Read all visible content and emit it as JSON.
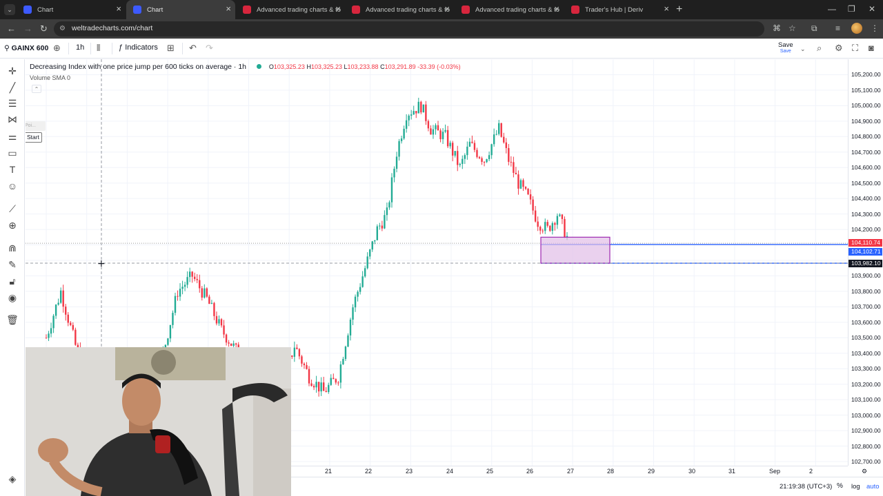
{
  "browser": {
    "tabs": [
      {
        "title": "Chart",
        "favicon_color": "#3d5afe",
        "active": false
      },
      {
        "title": "Chart",
        "favicon_color": "#3d5afe",
        "active": true
      },
      {
        "title": "Advanced trading charts & tools",
        "favicon_color": "#d7263d",
        "active": false
      },
      {
        "title": "Advanced trading charts & tools",
        "favicon_color": "#d7263d",
        "active": false
      },
      {
        "title": "Advanced trading charts & tools",
        "favicon_color": "#d7263d",
        "active": false
      },
      {
        "title": "Trader's Hub | Deriv",
        "favicon_color": "#d7263d",
        "active": false
      }
    ],
    "url": "weltradecharts.com/chart"
  },
  "toolbar": {
    "symbol": "GAINX 600",
    "interval": "1h",
    "indicators_label": "Indicators",
    "save_label": "Save",
    "save_sub": "Save"
  },
  "chart": {
    "title": "Decreasing Index with one price jump per 600 ticks on average · 1h",
    "ohlc": {
      "o_label": "O",
      "o": "103,325.23",
      "h_label": "H",
      "h": "103,325.23",
      "l_label": "L",
      "l": "103,233.88",
      "c_label": "C",
      "c": "103,291.89",
      "change": "-33.39 (-0.03%)"
    },
    "volume_label": "Volume SMA",
    "volume_value": "0",
    "poi_label": "Poi...",
    "start_label": "Start",
    "colors": {
      "up": "#22ab94",
      "down": "#f23645",
      "zone_fill": "#e1bee7",
      "zone_stroke": "#9c27b0",
      "line": "#2962ff"
    }
  },
  "chart_data": {
    "type": "candlestick",
    "ylim": [
      102700,
      105300
    ],
    "price_ticks": [
      "105,200.00",
      "105,100.00",
      "105,000.00",
      "104,900.00",
      "104,800.00",
      "104,700.00",
      "104,600.00",
      "104,500.00",
      "104,400.00",
      "104,300.00",
      "104,200.00",
      "103,900.00",
      "103,800.00",
      "103,700.00",
      "103,600.00",
      "103,500.00",
      "103,400.00",
      "103,300.00",
      "103,200.00",
      "103,100.00",
      "103,000.00",
      "102,900.00",
      "102,800.00",
      "102,700.00"
    ],
    "time_ticks": [
      "21",
      "22",
      "23",
      "24",
      "25",
      "26",
      "27",
      "28",
      "29",
      "30",
      "31",
      "Sep",
      "2"
    ],
    "price_labels": [
      {
        "text": "104,110.74",
        "color": "#f23645",
        "value": 104110.74
      },
      {
        "text": "104,102.71",
        "color": "#2962ff",
        "value": 104102.71
      },
      {
        "text": "103,982.10",
        "color": "#131722",
        "value": 103982.1
      }
    ],
    "path_points": [
      [
        0,
        103500
      ],
      [
        6,
        103800
      ],
      [
        12,
        103450
      ],
      [
        18,
        103200
      ],
      [
        24,
        103050
      ],
      [
        30,
        103000
      ],
      [
        36,
        103100
      ],
      [
        42,
        103200
      ],
      [
        48,
        103400
      ],
      [
        54,
        103800
      ],
      [
        60,
        103900
      ],
      [
        66,
        103750
      ],
      [
        72,
        103550
      ],
      [
        78,
        103420
      ],
      [
        84,
        103250
      ],
      [
        90,
        102950
      ],
      [
        96,
        103150
      ],
      [
        102,
        103450
      ],
      [
        108,
        103250
      ],
      [
        114,
        103150
      ],
      [
        120,
        103250
      ],
      [
        126,
        103700
      ],
      [
        132,
        104000
      ],
      [
        136,
        104200
      ],
      [
        140,
        104300
      ],
      [
        144,
        104700
      ],
      [
        148,
        104950
      ],
      [
        154,
        105000
      ],
      [
        158,
        104850
      ],
      [
        164,
        104800
      ],
      [
        170,
        104600
      ],
      [
        174,
        104750
      ],
      [
        180,
        104650
      ],
      [
        186,
        104850
      ],
      [
        190,
        104650
      ],
      [
        194,
        104500
      ],
      [
        198,
        104400
      ],
      [
        202,
        104250
      ],
      [
        206,
        104200
      ],
      [
        210,
        104300
      ],
      [
        214,
        104150
      ]
    ]
  },
  "bottom": {
    "clock": "21:19:38 (UTC+3)",
    "pct": "%",
    "log": "log",
    "auto": "auto"
  }
}
